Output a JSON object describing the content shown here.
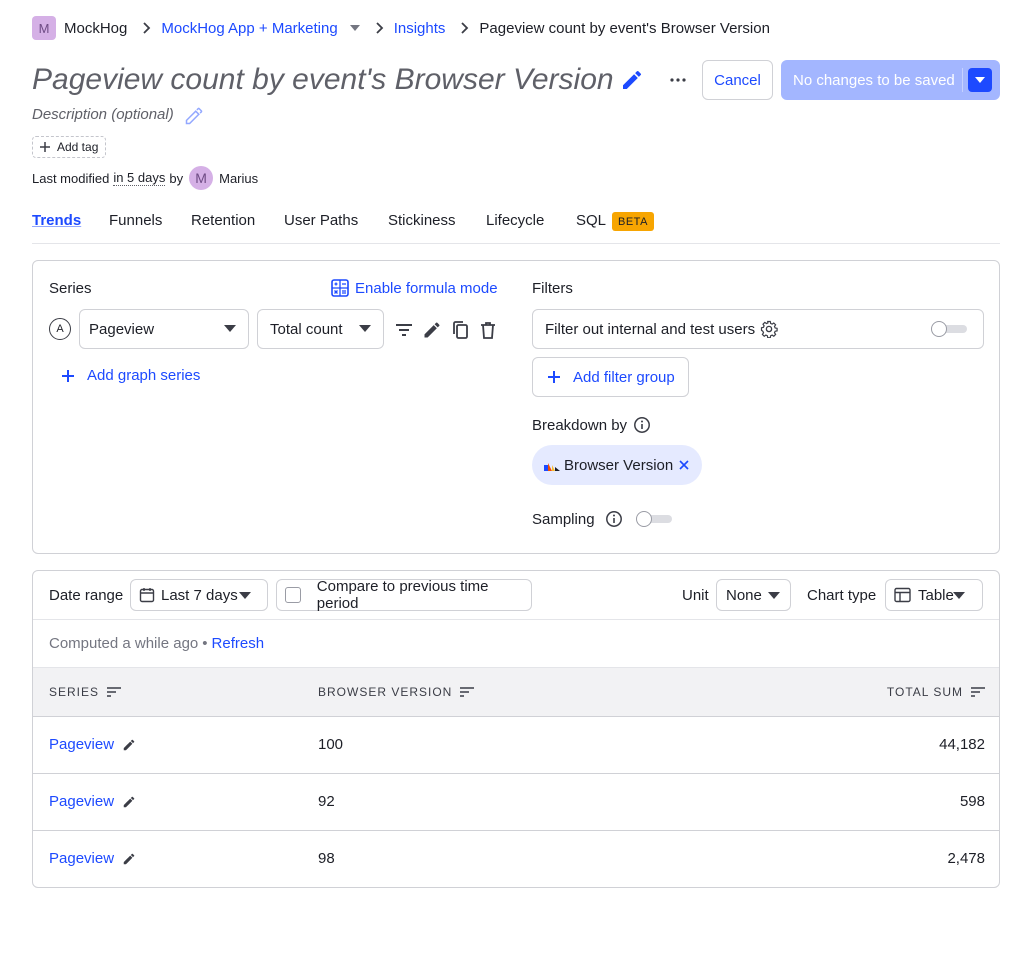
{
  "breadcrumb": {
    "org_initial": "M",
    "org": "MockHog",
    "project": "MockHog App + Marketing",
    "section": "Insights",
    "current": "Pageview count by event's Browser Version"
  },
  "header": {
    "title": "Pageview count by event's Browser Version",
    "cancel_label": "Cancel",
    "save_label": "No changes to be saved",
    "description_placeholder": "Description (optional)",
    "add_tag_label": "Add tag"
  },
  "modified": {
    "prefix": "Last modified",
    "when": "in 5 days",
    "by": "by",
    "user_initial": "M",
    "user": "Marius"
  },
  "tabs": [
    "Trends",
    "Funnels",
    "Retention",
    "User Paths",
    "Stickiness",
    "Lifecycle",
    "SQL"
  ],
  "active_tab": "Trends",
  "sql_badge": "BETA",
  "query": {
    "series_label": "Series",
    "formula_label": "Enable formula mode",
    "series_letter": "A",
    "event": "Pageview",
    "math": "Total count",
    "add_series_label": "Add graph series",
    "filters_label": "Filters",
    "filter_internal_label": "Filter out internal and test users",
    "filter_internal_enabled": false,
    "add_filter_group_label": "Add filter group",
    "breakdown_label": "Breakdown by",
    "breakdown_value": "Browser Version",
    "sampling_label": "Sampling",
    "sampling_enabled": false
  },
  "results": {
    "date_range_label": "Date range",
    "date_range_value": "Last 7 days",
    "compare_label": "Compare to previous time period",
    "compare_checked": false,
    "unit_label": "Unit",
    "unit_value": "None",
    "chart_type_label": "Chart type",
    "chart_type_value": "Table",
    "computed_text": "Computed a while ago",
    "bullet": "•",
    "refresh_label": "Refresh",
    "columns": [
      "SERIES",
      "BROWSER VERSION",
      "TOTAL SUM"
    ],
    "rows": [
      {
        "series": "Pageview",
        "version": "100",
        "total": "44,182"
      },
      {
        "series": "Pageview",
        "version": "92",
        "total": "598"
      },
      {
        "series": "Pageview",
        "version": "98",
        "total": "2,478"
      }
    ]
  },
  "colors": {
    "primary": "#1d4aff",
    "primary_disabled": "#a3b6ff",
    "beta_badge": "#f7a501",
    "avatar": "#d5b0e6",
    "breakdown_pill": "#e5eaff"
  },
  "icons": [
    "chevron-right-icon",
    "chevron-down-icon",
    "pencil-icon",
    "more-icon",
    "plus-icon",
    "calculator-icon",
    "filter-icon",
    "copy-icon",
    "trash-icon",
    "gear-icon",
    "info-icon",
    "chrome-icon",
    "close-icon",
    "calendar-icon",
    "table-icon",
    "sort-icon"
  ]
}
